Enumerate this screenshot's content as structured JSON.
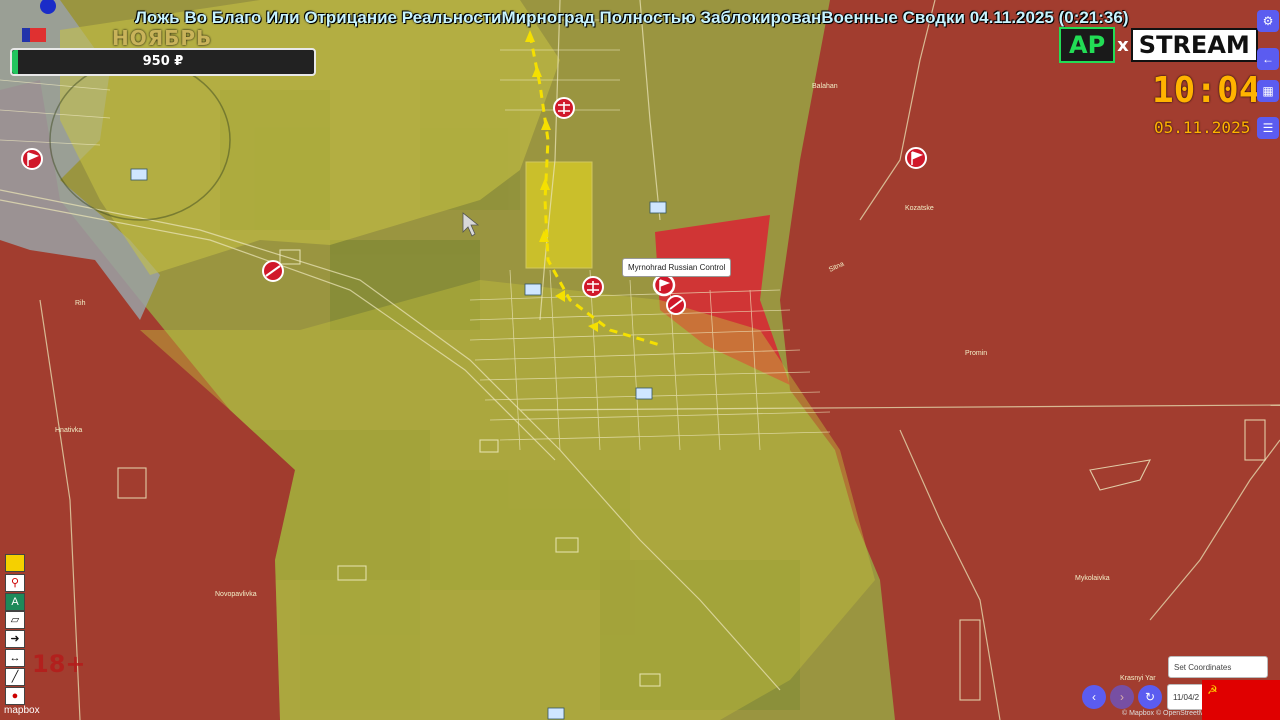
{
  "ticker_text": "Ложь Во Благо Или Отрицание РеальностиМирноград Полностью ЗаблокированВоенные Сводки 04.11.2025 (0:21:36)",
  "month_label": "НОЯБРЬ",
  "donation": {
    "amount": "950 ₽",
    "progress": 0.02
  },
  "logo": {
    "left": "AP",
    "separator": "x",
    "right": "STREAM"
  },
  "clock": {
    "time": "10:04",
    "date": "05.11.2025"
  },
  "colors": {
    "russian_control": "#a83a35",
    "contested": "#b4b22e",
    "ukraine_control": "#8c8c3a",
    "ticker": "#c8f4ff",
    "clock": "#ffb300",
    "accent_button": "#5b5cf0"
  },
  "map": {
    "popup": "Myrnohrad Russian Control",
    "place_labels": [
      "Balahan",
      "Kozatske",
      "Promin",
      "Mykolaivka",
      "Hnativka",
      "Novopavlivka",
      "Rih",
      "Krasnyi Yar",
      "Sitna"
    ],
    "advance_arrow_color": "#f5e000"
  },
  "controls": {
    "set_coordinates_placeholder": "Set Coordinates",
    "date_value": "11/04/2",
    "nav_prev": "‹",
    "nav_next": "›",
    "refresh": "↻"
  },
  "age_rating": "18+",
  "mapbox_label": "mapbox",
  "attribution": "© Mapbox © OpenStreetMap",
  "flag_symbol": "☭"
}
